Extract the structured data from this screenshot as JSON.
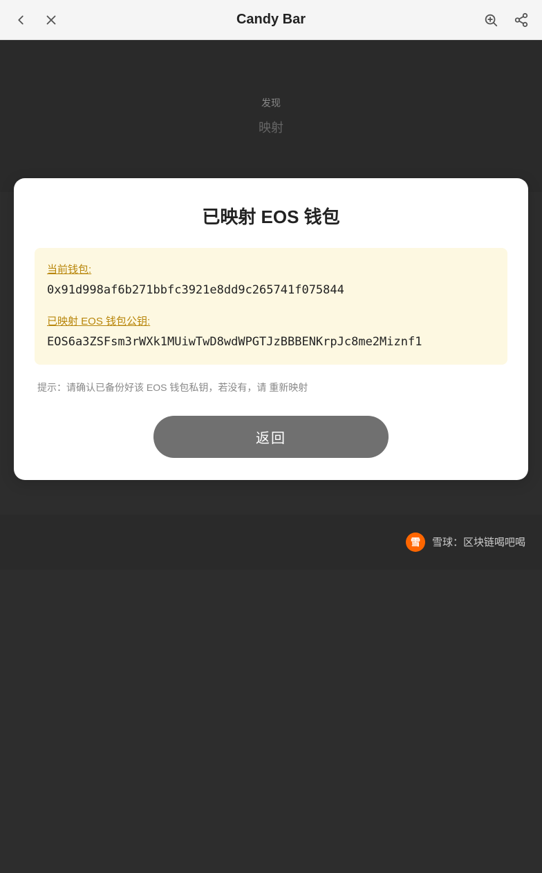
{
  "nav": {
    "title": "Candy Bar",
    "back_label": "back",
    "close_label": "close",
    "scan_label": "scan",
    "share_label": "share"
  },
  "dark_area": {
    "text1": "发现",
    "text2": "映射"
  },
  "card": {
    "title": "已映射 EOS 钱包",
    "info_box": {
      "wallet_label": "当前钱包:",
      "wallet_value": "0x91d998af6b271bbfc3921e8dd9c265741f075844",
      "eos_label": "已映射 EOS 钱包公钥:",
      "eos_value": "EOS6a3ZSFsm3rWXk1MUiwTwD8wdWPGTJzBBBENKrpJc8me2Miznf1"
    },
    "hint": "提示：请确认已备份好该 EOS 钱包私钥，若没有，请 重新映射",
    "return_button": "返回"
  },
  "footer": {
    "logo_text": "雪",
    "brand_text": "雪球",
    "separator": "：",
    "wx_text": "区块链喝吧喝",
    "full_text": "雪球：区块链喝吧喝"
  }
}
